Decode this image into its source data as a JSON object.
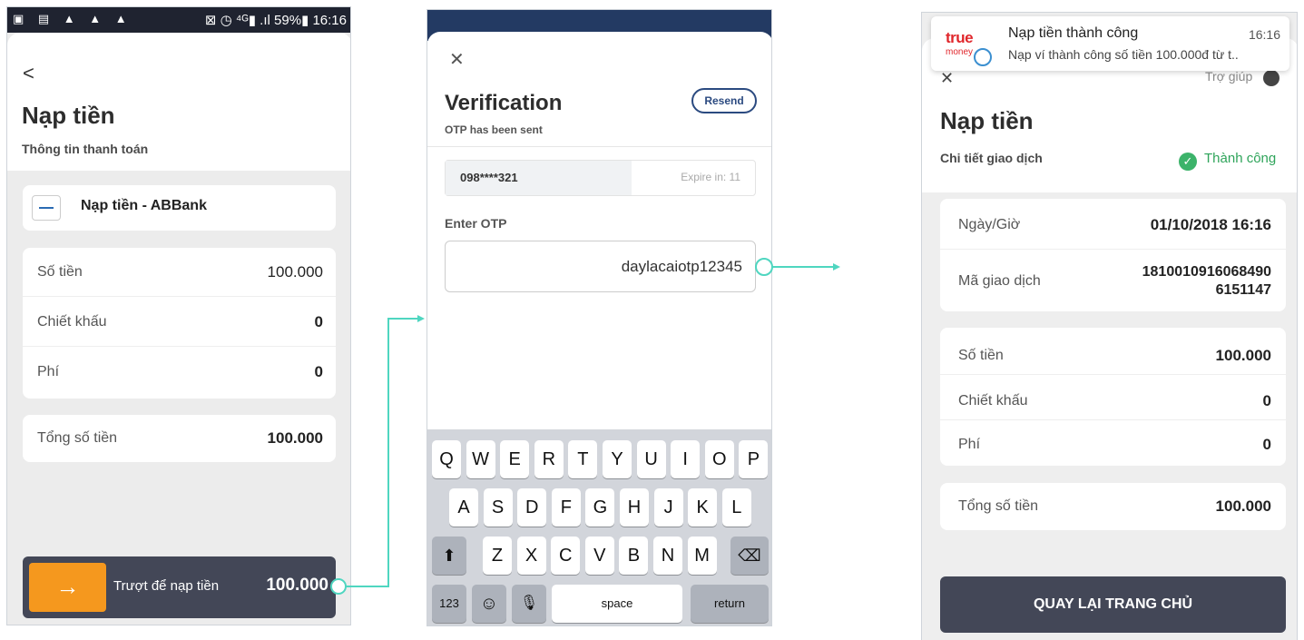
{
  "screen1": {
    "status_left": "▣ ▤ ▲ ▲ ▲",
    "status_right": "⊠ ◷ ⁴ᴳ▮ .ıl 59%▮ 16:16",
    "back": "<",
    "title": "Nạp tiền",
    "subtitle": "Thông tin thanh toán",
    "bank_name": "Nạp tiền - ABBank",
    "rows": [
      {
        "label": "Số tiền",
        "value": "100.000"
      },
      {
        "label": "Chiết khấu",
        "value": "0"
      },
      {
        "label": "Phí",
        "value": "0"
      }
    ],
    "total_label": "Tổng số tiền",
    "total_value": "100.000",
    "slider_arrow": "→",
    "slider_label": "Trượt để nạp tiền",
    "slider_amount": "100.000"
  },
  "screen2": {
    "close": "✕",
    "title": "Verification",
    "resend": "Resend",
    "otp_sent": "OTP has been sent",
    "phone": "098****321",
    "expire": "Expire in: 11",
    "enter_otp": "Enter OTP",
    "otp_value": "daylacaiotp12345",
    "keys_row1": [
      "Q",
      "W",
      "E",
      "R",
      "T",
      "Y",
      "U",
      "I",
      "O",
      "P"
    ],
    "keys_row2": [
      "A",
      "S",
      "D",
      "F",
      "G",
      "H",
      "J",
      "K",
      "L"
    ],
    "keys_row3": [
      "Z",
      "X",
      "C",
      "V",
      "B",
      "N",
      "M"
    ],
    "key_shift": "⬆",
    "key_delete": "⌫",
    "key_123": "123",
    "key_emoji": "☺",
    "key_mic": "🎙",
    "key_space": "space",
    "key_return": "return"
  },
  "screen3": {
    "notif_logo": "true",
    "notif_logo_sub": "money",
    "notif_title": "Nạp tiền thành công",
    "notif_time": "16:16",
    "notif_body": "Nạp ví thành công số tiền 100.000đ từ t..",
    "close": "✕",
    "help": "Trợ giúp",
    "title": "Nạp tiền",
    "subtitle": "Chi tiết giao dịch",
    "status": "Thành công",
    "date_label": "Ngày/Giờ",
    "date_value": "01/10/2018 16:16",
    "txid_label": "Mã giao dịch",
    "txid_line1": "1810010916068490",
    "txid_line2": "6151147",
    "rows": [
      {
        "label": "Số tiền",
        "value": "100.000"
      },
      {
        "label": "Chiết khấu",
        "value": "0"
      },
      {
        "label": "Phí",
        "value": "0"
      }
    ],
    "total_label": "Tổng số tiền",
    "total_value": "100.000",
    "home_button": "QUAY LẠI TRANG CHỦ"
  },
  "colors": {
    "accent_orange": "#f5981e",
    "dark_button": "#434757",
    "arrow": "#4fd6c0",
    "success": "#3cb36a"
  }
}
